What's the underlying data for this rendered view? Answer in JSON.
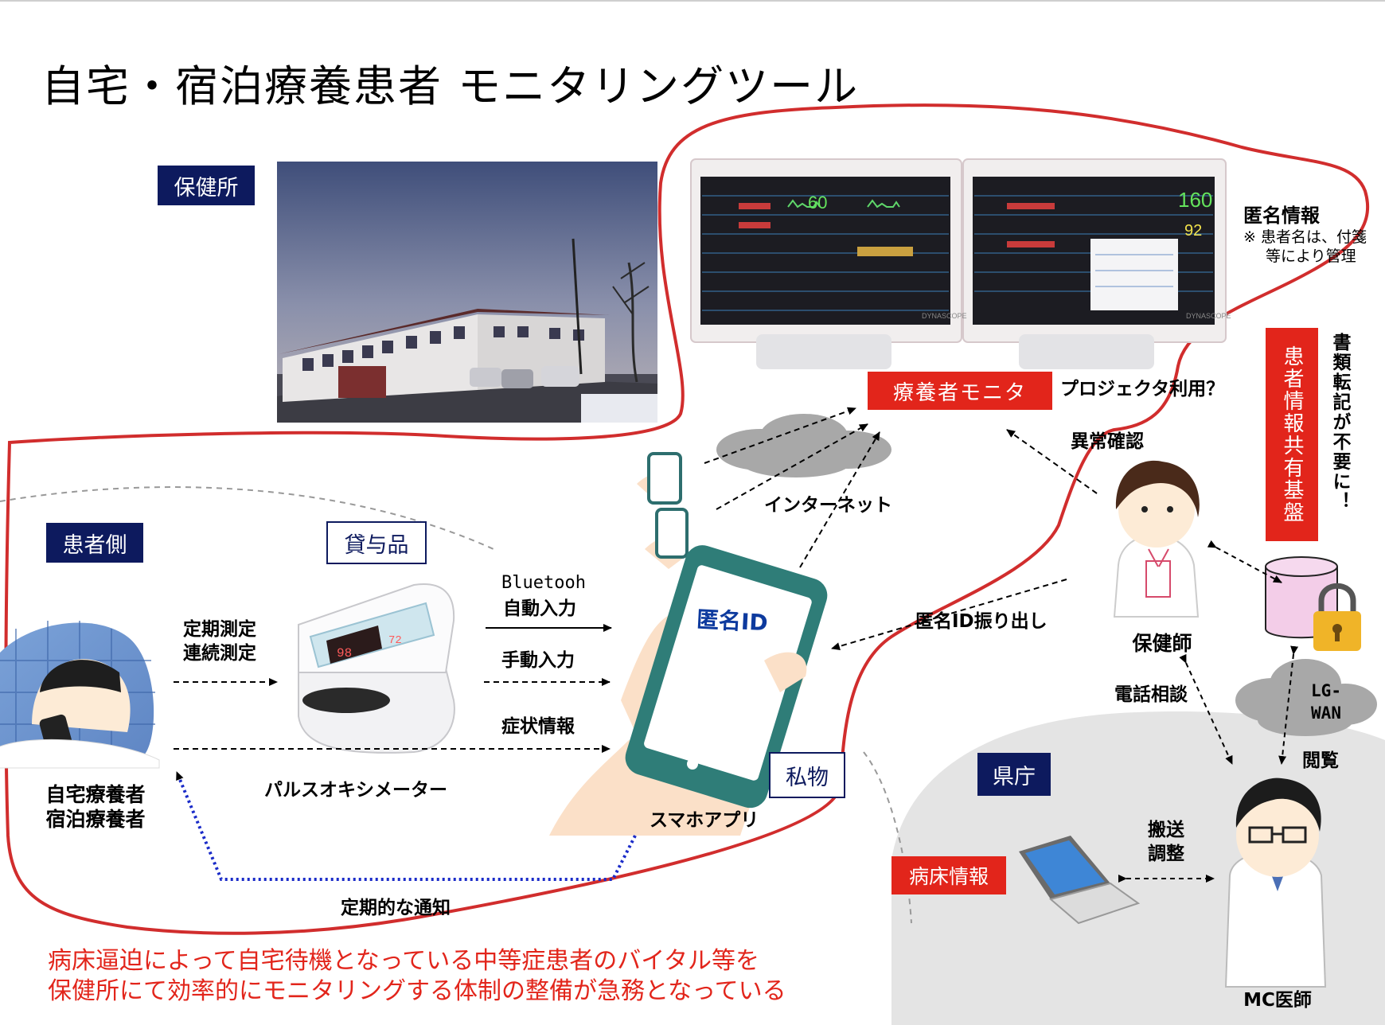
{
  "title": "自宅・宿泊療養患者 モニタリングツール",
  "labels": {
    "health_center": "保健所",
    "patient_side": "患者側",
    "rental": "貸与品",
    "private": "私物",
    "prefecture": "県庁"
  },
  "monitor": {
    "label": "療養者モニタ",
    "projector": "プロジェクタ利用？",
    "anon_info_title": "匿名情報",
    "anon_info_note1": "※ 患者名は、付箋",
    "anon_info_note2": "等により管理"
  },
  "platform": {
    "label": "患者情報共有基盤",
    "note": "書類転記が不要に！"
  },
  "flows": {
    "periodic_measure1": "定期測定",
    "periodic_measure2": "連続測定",
    "bluetooth1": "Bluetooh",
    "bluetooth2": "自動入力",
    "manual_input": "手動入力",
    "symptom_info": "症状情報",
    "internet": "インターネット",
    "anomaly_check": "異常確認",
    "anon_id_issue": "匿名ID振り出し",
    "phone_consult": "電話相談",
    "transport1": "搬送",
    "transport2": "調整",
    "lgwan1": "LG-",
    "lgwan2": "WAN",
    "view": "閲覧",
    "periodic_notice": "定期的な通知"
  },
  "actors": {
    "patient1": "自宅療養者",
    "patient2": "宿泊療養者",
    "oximeter": "パルスオキシメーター",
    "smartphone_app": "スマホアプリ",
    "anon_id": "匿名ID",
    "nurse": "保健師",
    "doctor": "MC医師",
    "bed_info": "病床情報"
  },
  "monitor_readouts": {
    "left_big": "60",
    "right_big": "160",
    "right_small": "92",
    "brand": "DYNASCOPE"
  },
  "oximeter_display": {
    "spo2": "98",
    "pulse": "72"
  },
  "footer": {
    "line1": "病床逼迫によって自宅待機となっている中等症患者のバイタル等を",
    "line2": "保健所にて効率的にモニタリングする体制の整備が急務となっている"
  },
  "colors": {
    "accent_red": "#e2251b",
    "navy": "#0d1a5e",
    "dotted_blue": "#1a2bc8",
    "cloud_gray": "#a8a8a8"
  }
}
